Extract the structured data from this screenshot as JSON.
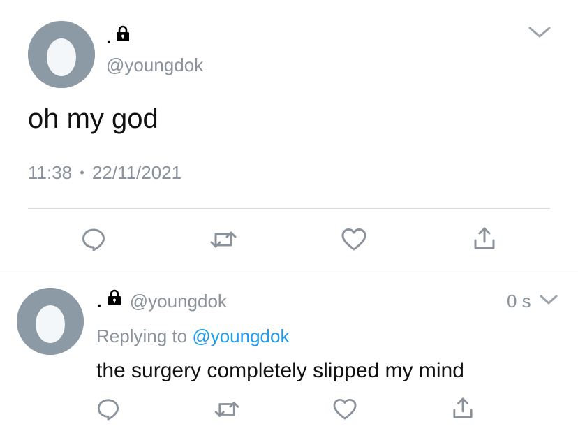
{
  "main_tweet": {
    "display_name": ".",
    "handle": "@youngdok",
    "text": "oh my god",
    "time": "11:38",
    "separator": "•",
    "date": "22/11/2021",
    "icons": [
      "reply-icon",
      "retweet-icon",
      "like-icon",
      "share-icon",
      "chevron-down-icon",
      "lock-icon"
    ]
  },
  "reply_tweet": {
    "display_name": ".",
    "handle": "@youngdok",
    "age": "0 s",
    "replying_prefix": "Replying to",
    "replying_handle": "@youngdok",
    "text": "the surgery completely slipped my mind",
    "icons": [
      "reply-icon",
      "retweet-icon",
      "like-icon",
      "share-icon",
      "chevron-down-icon",
      "lock-icon"
    ]
  },
  "colors": {
    "avatar_bg": "#8c9aa6",
    "egg": "#f4f7fa",
    "secondary_text": "#8a939b",
    "link": "#1d9bf0",
    "divider": "#d7dbdf",
    "icon": "#8a939b"
  }
}
